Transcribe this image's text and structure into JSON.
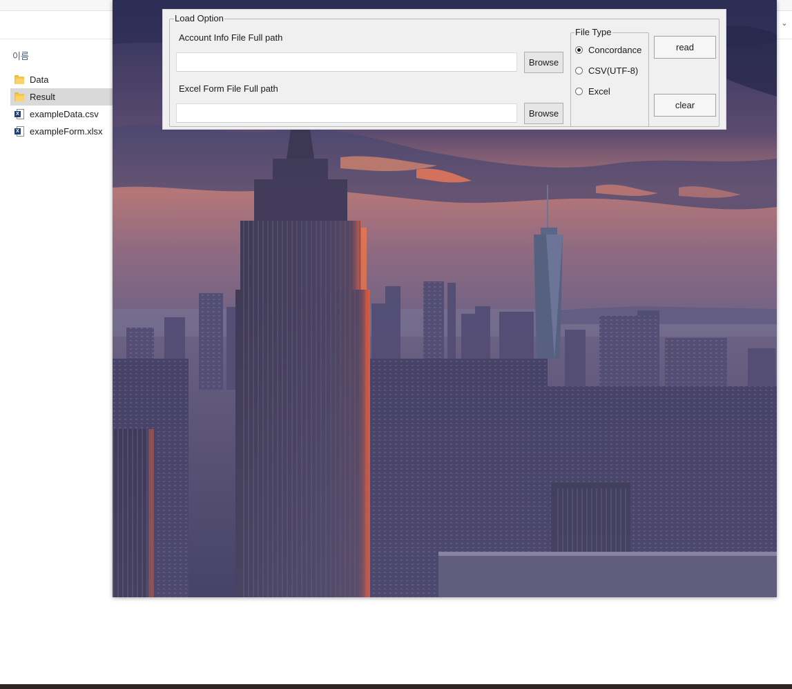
{
  "explorer": {
    "column_header": "이름",
    "items": [
      {
        "label": "Data",
        "type": "folder"
      },
      {
        "label": "Result",
        "type": "folder",
        "selected": true
      },
      {
        "label": "exampleData.csv",
        "type": "excel-file"
      },
      {
        "label": "exampleForm.xlsx",
        "type": "excel-file"
      }
    ]
  },
  "app": {
    "background_image": "city-skyline-at-dusk",
    "load_option": {
      "title": "Load Option",
      "account_info_label": "Account Info File Full path",
      "account_info_value": "",
      "account_browse_label": "Browse",
      "excel_form_label": "Excel Form File Full path",
      "excel_form_value": "",
      "excel_browse_label": "Browse"
    },
    "file_type": {
      "title": "File Type",
      "options": [
        {
          "label": "Concordance",
          "selected": true
        },
        {
          "label": "CSV(UTF-8)",
          "selected": false
        },
        {
          "label": "Excel",
          "selected": false
        }
      ]
    },
    "read_label": "read",
    "clear_label": "clear"
  },
  "colors": {
    "panel_background": "#f0f0f0",
    "sky_top": "#3a3b62",
    "sky_glow": "#c88472",
    "city": "#4a4670"
  }
}
